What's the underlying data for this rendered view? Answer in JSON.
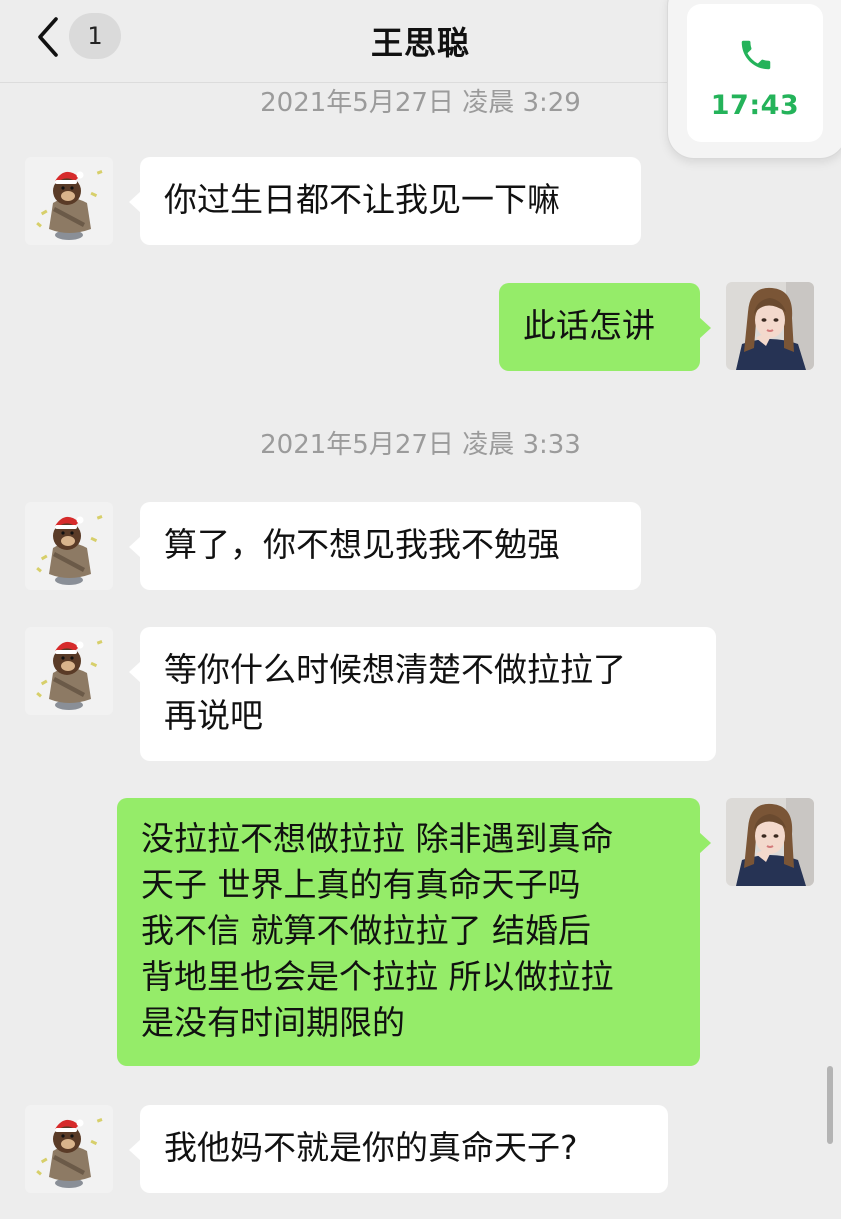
{
  "header": {
    "back_badge": "1",
    "title": "王思聪"
  },
  "call_widget": {
    "icon": "phone-icon",
    "duration": "17:43",
    "accent_color": "#24b35a"
  },
  "colors": {
    "background": "#ededed",
    "incoming_bubble": "#ffffff",
    "outgoing_bubble": "#95ec69"
  },
  "timestamps": [
    "2021年5月27日 凌晨 3:29",
    "2021年5月27日 凌晨 3:33"
  ],
  "messages": [
    {
      "from": "contact",
      "text": "你过生日都不让我见一下嘛"
    },
    {
      "from": "me",
      "text": "此话怎讲"
    },
    {
      "from": "contact",
      "text": "算了，你不想见我我不勉强"
    },
    {
      "from": "contact",
      "text": "等你什么时候想清楚不做拉拉了\n再说吧"
    },
    {
      "from": "me",
      "text": "没拉拉不想做拉拉 除非遇到真命\n天子 世界上真的有真命天子吗\n我不信 就算不做拉拉了 结婚后\n背地里也会是个拉拉 所以做拉拉\n是没有时间期限的"
    },
    {
      "from": "contact",
      "text": "我他妈不就是你的真命天子?"
    }
  ]
}
